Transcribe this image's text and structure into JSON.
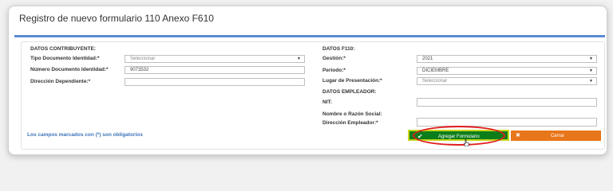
{
  "dialog": {
    "title": "Registro de nuevo formulario 110 Anexo F610"
  },
  "left": {
    "section_title": "DATOS CONTRIBUYENTE:",
    "tipo_label": "Tipo Documento Identidad:*",
    "tipo_value": "Seleccionar",
    "numero_label": "Número Documento Identidad:*",
    "numero_value": "9073532",
    "direccion_label": "Dirección Dependiente:*",
    "direccion_value": ""
  },
  "right": {
    "section_title": "DATOS F110:",
    "gestion_label": "Gestión:*",
    "gestion_value": "2021",
    "periodo_label": "Periodo:*",
    "periodo_value": "DICIEMBRE",
    "lugar_label": "Lugar de Presentación:*",
    "lugar_value": "Seleccionar",
    "empleador_section": "DATOS EMPLEADOR:",
    "nit_label": "NIT:",
    "nit_value": "",
    "nombre_label": "Nombre o Razón Social:",
    "direccion_emp_label": "Dirección Empleador:*",
    "direccion_emp_value": ""
  },
  "footer": {
    "note": "Los campos marcados con (*) son obligatorios",
    "add_button": "Agregar Formulario",
    "cancel_button": "Cerrar"
  },
  "icons": {
    "add": "check-icon",
    "cancel": "close-icon",
    "dropdown": "chevron-down-icon"
  },
  "colors": {
    "title_rule": "#5b8bd3",
    "add_button": "#0c7d1b",
    "cancel_button": "#e8761b",
    "highlight": "#e01d1d",
    "note": "#3d74b8"
  }
}
